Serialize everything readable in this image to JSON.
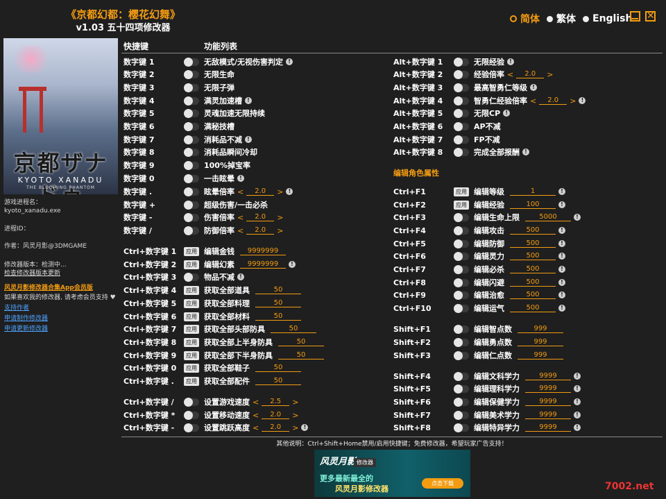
{
  "header": {
    "title": "《京都幻都：樱花幻舞》",
    "subtitle": "v1.03 五十四项修改器"
  },
  "languages": [
    {
      "label": "简体",
      "selected": true
    },
    {
      "label": "繁体",
      "selected": false
    },
    {
      "label": "English",
      "selected": false
    }
  ],
  "window": {
    "minimize_icon": "minimize-icon",
    "close_icon": "close-icon"
  },
  "cover": {
    "logo_text": "京都ザナドゥ",
    "logo_en": "KYOTO XANADU",
    "logo_sub": "THE BLOOMING PHANTOM"
  },
  "sidebar": {
    "process_label": "游戏进程名：",
    "process_name": "kyoto_xanadu.exe",
    "pid_label": "进程ID：",
    "author": "作者：风灵月影@3DMGAME",
    "version": "修改器版本：检测中...",
    "check_update": "检查修改器版本更新",
    "app_link": "风灵月影修改器合集App会员版",
    "support_text": "如果喜欢我的修改器, 请考虑会员支持 ♥",
    "support_author": "支持作者",
    "request_trainer": "申请制作修改器",
    "request_update": "申请更新修改器"
  },
  "columns": {
    "hotkey": "快捷键",
    "function": "功能列表"
  },
  "left_rows": [
    {
      "key": "数字键 1",
      "ctl": "toggle",
      "label": "无敌模式/无视伤害判定",
      "info": true
    },
    {
      "key": "数字键 2",
      "ctl": "toggle",
      "label": "无限生命"
    },
    {
      "key": "数字键 3",
      "ctl": "toggle",
      "label": "无限子弹"
    },
    {
      "key": "数字键 4",
      "ctl": "toggle",
      "label": "满灵加速槽",
      "info": true
    },
    {
      "key": "数字键 5",
      "ctl": "toggle",
      "label": "灵魂加速无限持续"
    },
    {
      "key": "数字键 6",
      "ctl": "toggle",
      "label": "满秘技槽"
    },
    {
      "key": "数字键 7",
      "ctl": "toggle",
      "label": "消耗品不减",
      "info": true
    },
    {
      "key": "数字键 8",
      "ctl": "toggle",
      "label": "消耗品瞬间冷却"
    },
    {
      "key": "数字键 9",
      "ctl": "toggle",
      "label": "100%掉宝率"
    },
    {
      "key": "数字键 0",
      "ctl": "toggle",
      "label": "一击眩晕",
      "info": true
    },
    {
      "key": "数字键 .",
      "ctl": "toggle",
      "label": "眩晕倍率",
      "stepper": "2.0",
      "info": true
    },
    {
      "key": "数字键 +",
      "ctl": "toggle",
      "label": "超级伤害/一击必杀"
    },
    {
      "key": "数字键 -",
      "ctl": "toggle",
      "label": "伤害倍率",
      "stepper": "2.0"
    },
    {
      "key": "数字键 /",
      "ctl": "toggle",
      "label": "防御倍率",
      "stepper": "2.0"
    },
    {
      "key": "Ctrl+数字键 1",
      "ctl": "apply",
      "label": "编辑金钱",
      "value": "9999999"
    },
    {
      "key": "Ctrl+数字键 2",
      "ctl": "apply",
      "label": "编辑幻素",
      "value": "9999999",
      "info": true
    },
    {
      "key": "Ctrl+数字键 3",
      "ctl": "toggle",
      "label": "物品不减",
      "info": true
    },
    {
      "key": "Ctrl+数字键 4",
      "ctl": "apply",
      "label": "获取全部道具",
      "value": "50"
    },
    {
      "key": "Ctrl+数字键 5",
      "ctl": "apply",
      "label": "获取全部料理",
      "value": "50"
    },
    {
      "key": "Ctrl+数字键 6",
      "ctl": "apply",
      "label": "获取全部材料",
      "value": "50"
    },
    {
      "key": "Ctrl+数字键 7",
      "ctl": "apply",
      "label": "获取全部头部防具",
      "value": "50"
    },
    {
      "key": "Ctrl+数字键 8",
      "ctl": "apply",
      "label": "获取全部上半身防具",
      "value": "50"
    },
    {
      "key": "Ctrl+数字键 9",
      "ctl": "apply",
      "label": "获取全部下半身防具",
      "value": "50"
    },
    {
      "key": "Ctrl+数字键 0",
      "ctl": "apply",
      "label": "获取全部鞋子",
      "value": "50"
    },
    {
      "key": "Ctrl+数字键 .",
      "ctl": "apply",
      "label": "获取全部配件",
      "value": "50"
    },
    {
      "key": "Ctrl+数字键 /",
      "ctl": "toggle",
      "label": "设置游戏速度",
      "stepper": "2.5"
    },
    {
      "key": "Ctrl+数字键 *",
      "ctl": "toggle",
      "label": "设置移动速度",
      "stepper": "2.0"
    },
    {
      "key": "Ctrl+数字键 -",
      "ctl": "toggle",
      "label": "设置跳跃高度",
      "stepper": "2.0",
      "info": true
    }
  ],
  "right_rows": [
    {
      "key": "Alt+数字键 1",
      "ctl": "toggle",
      "label": "无限经验",
      "info": true
    },
    {
      "key": "Alt+数字键 2",
      "ctl": "toggle",
      "label": "经验倍率",
      "stepper": "2.0"
    },
    {
      "key": "Alt+数字键 3",
      "ctl": "toggle",
      "label": "最高智勇仁等级",
      "info": true
    },
    {
      "key": "Alt+数字键 4",
      "ctl": "toggle",
      "label": "智勇仁经验倍率",
      "stepper": "2.0",
      "info": true
    },
    {
      "key": "Alt+数字键 5",
      "ctl": "toggle",
      "label": "无限CP",
      "info": true
    },
    {
      "key": "Alt+数字键 6",
      "ctl": "toggle",
      "label": "AP不减"
    },
    {
      "key": "Alt+数字键 7",
      "ctl": "toggle",
      "label": "FP不减"
    },
    {
      "key": "Alt+数字键 8",
      "ctl": "toggle",
      "label": "完成全部报酬",
      "info": true
    },
    {
      "key": "Ctrl+F1",
      "ctl": "apply",
      "label": "编辑等级",
      "value": "1",
      "info": true
    },
    {
      "key": "Ctrl+F2",
      "ctl": "apply",
      "label": "编辑经验",
      "value": "100",
      "info": true
    },
    {
      "key": "Ctrl+F3",
      "ctl": "toggle",
      "label": "编辑生命上限",
      "value": "5000",
      "info": true
    },
    {
      "key": "Ctrl+F4",
      "ctl": "toggle",
      "label": "编辑攻击",
      "value": "500",
      "info": true
    },
    {
      "key": "Ctrl+F5",
      "ctl": "toggle",
      "label": "编辑防御",
      "value": "500",
      "info": true
    },
    {
      "key": "Ctrl+F6",
      "ctl": "toggle",
      "label": "编辑灵力",
      "value": "500",
      "info": true
    },
    {
      "key": "Ctrl+F7",
      "ctl": "toggle",
      "label": "编辑必杀",
      "value": "500",
      "info": true
    },
    {
      "key": "Ctrl+F8",
      "ctl": "toggle",
      "label": "编辑闪避",
      "value": "500",
      "info": true
    },
    {
      "key": "Ctrl+F9",
      "ctl": "toggle",
      "label": "编辑治愈",
      "value": "500",
      "info": true
    },
    {
      "key": "Ctrl+F10",
      "ctl": "toggle",
      "label": "编辑运气",
      "value": "500",
      "info": true
    },
    {
      "key": "Shift+F1",
      "ctl": "toggle",
      "label": "编辑智点数",
      "value": "999"
    },
    {
      "key": "Shift+F2",
      "ctl": "toggle",
      "label": "编辑勇点数",
      "value": "999"
    },
    {
      "key": "Shift+F3",
      "ctl": "toggle",
      "label": "编辑仁点数",
      "value": "999"
    },
    {
      "key": "Shift+F4",
      "ctl": "toggle",
      "label": "编辑文科学力",
      "value": "9999",
      "info": true
    },
    {
      "key": "Shift+F5",
      "ctl": "toggle",
      "label": "编辑理科学力",
      "value": "9999",
      "info": true
    },
    {
      "key": "Shift+F6",
      "ctl": "toggle",
      "label": "编辑保健学力",
      "value": "9999",
      "info": true
    },
    {
      "key": "Shift+F7",
      "ctl": "toggle",
      "label": "编辑美术学力",
      "value": "9999",
      "info": true
    },
    {
      "key": "Shift+F8",
      "ctl": "toggle",
      "label": "编辑特异学力",
      "value": "9999",
      "info": true
    }
  ],
  "section_title": "编辑角色属性",
  "apply_label": "应用",
  "footer_note": "其他说明：Ctrl+Shift+Home禁用/启用快捷键；免费修改器，希望玩家广告支持！",
  "banner": {
    "brand": "风灵月影",
    "tag": "修改器",
    "line1": "更多最新最全的",
    "line2": "风灵月影修改器",
    "button": "点击下载"
  },
  "watermark": "7002.net"
}
